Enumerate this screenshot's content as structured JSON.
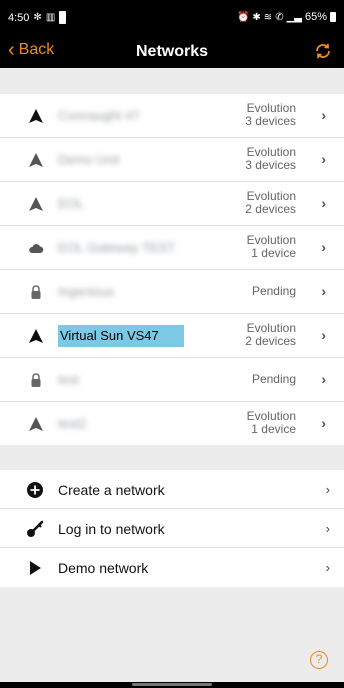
{
  "status_bar": {
    "time": "4:50",
    "battery": "65%",
    "left_icons": [
      "gear-icon",
      "sim-icon"
    ],
    "right_icons": [
      "alarm-icon",
      "bluetooth-icon",
      "wifi-icon",
      "call-icon",
      "signal-icon"
    ]
  },
  "nav": {
    "back_label": "Back",
    "title": "Networks",
    "accent": "#f08a1e"
  },
  "networks": [
    {
      "name": "Connaught 47",
      "meta_top": "Evolution",
      "meta_bottom": "3 devices",
      "icon": "triangle-icon",
      "active": true
    },
    {
      "name": "Demo Unit",
      "meta_top": "Evolution",
      "meta_bottom": "3 devices",
      "icon": "triangle-icon",
      "active": false
    },
    {
      "name": "EOL",
      "meta_top": "Evolution",
      "meta_bottom": "2 devices",
      "icon": "triangle-icon",
      "active": false
    },
    {
      "name": "EOL Gateway TEST",
      "meta_top": "Evolution",
      "meta_bottom": "1 device",
      "icon": "cloud-icon",
      "active": false
    },
    {
      "name": "Ingenious",
      "meta_top": "Pending",
      "meta_bottom": "",
      "icon": "lock-icon",
      "active": false
    },
    {
      "name": "Virtual Sun VS47",
      "meta_top": "Evolution",
      "meta_bottom": "2 devices",
      "icon": "triangle-icon",
      "active": true,
      "highlight": "#7cc9e6"
    },
    {
      "name": "test",
      "meta_top": "Pending",
      "meta_bottom": "",
      "icon": "lock-icon",
      "active": false
    },
    {
      "name": "test2",
      "meta_top": "Evolution",
      "meta_bottom": "1 device",
      "icon": "triangle-icon",
      "active": false
    }
  ],
  "actions": [
    {
      "label": "Create a network",
      "icon": "plus-circle-icon"
    },
    {
      "label": "Log in to network",
      "icon": "key-icon"
    },
    {
      "label": "Demo network",
      "icon": "play-icon"
    }
  ],
  "help_label": "?"
}
